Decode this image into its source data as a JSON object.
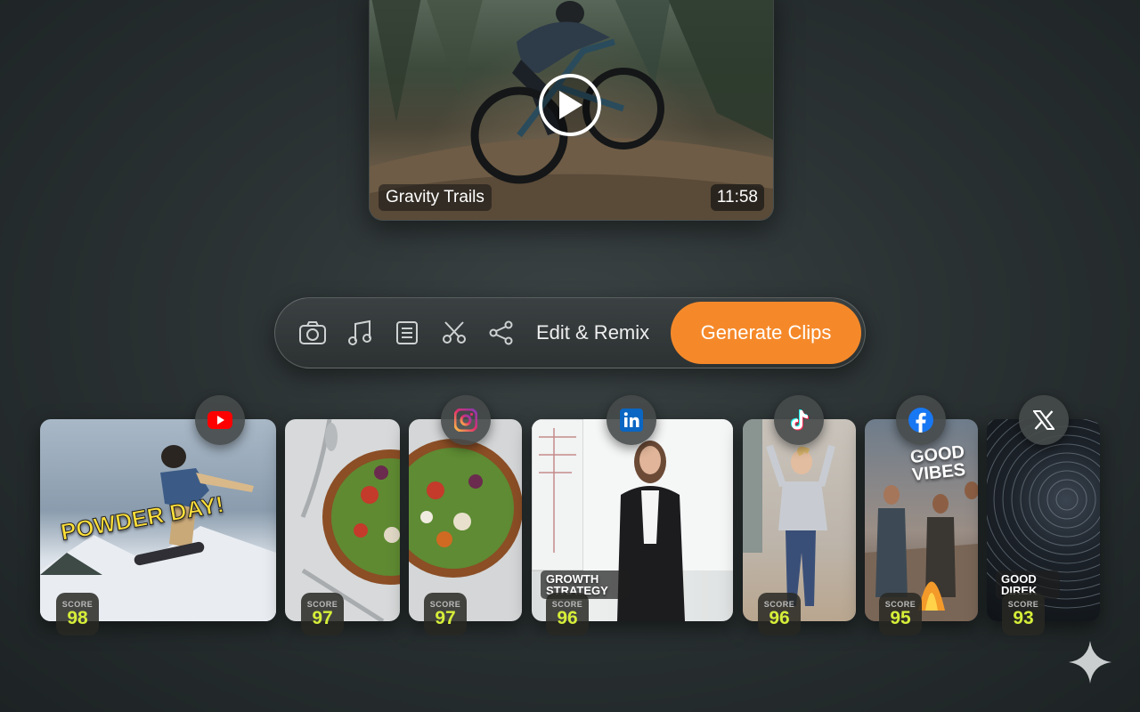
{
  "hero": {
    "title": "Gravity Trails",
    "duration": "11:58"
  },
  "toolbar": {
    "icons": [
      "camera-icon",
      "music-note-icon",
      "document-icon",
      "scissors-icon",
      "share-icon"
    ],
    "edit_label": "Edit & Remix",
    "generate_label": "Generate Clips",
    "accent": "#f5892a"
  },
  "score_label": "SCORE",
  "score_color": "#d6ee39",
  "clips": [
    {
      "overlay": "POWDER DAY!",
      "score": "98"
    },
    {
      "overlay": "",
      "score": "97"
    },
    {
      "overlay": "",
      "score": "97"
    },
    {
      "overlay": "GROWTH STRATEGY",
      "score": "96"
    },
    {
      "overlay": "",
      "score": "96"
    },
    {
      "overlay": "GOOD VIBES",
      "score": "95"
    },
    {
      "overlay": "GOOD DIREK",
      "score": "93"
    }
  ],
  "platforms": [
    "youtube-icon",
    "instagram-icon",
    "linkedin-icon",
    "tiktok-icon",
    "facebook-icon",
    "x-icon"
  ]
}
